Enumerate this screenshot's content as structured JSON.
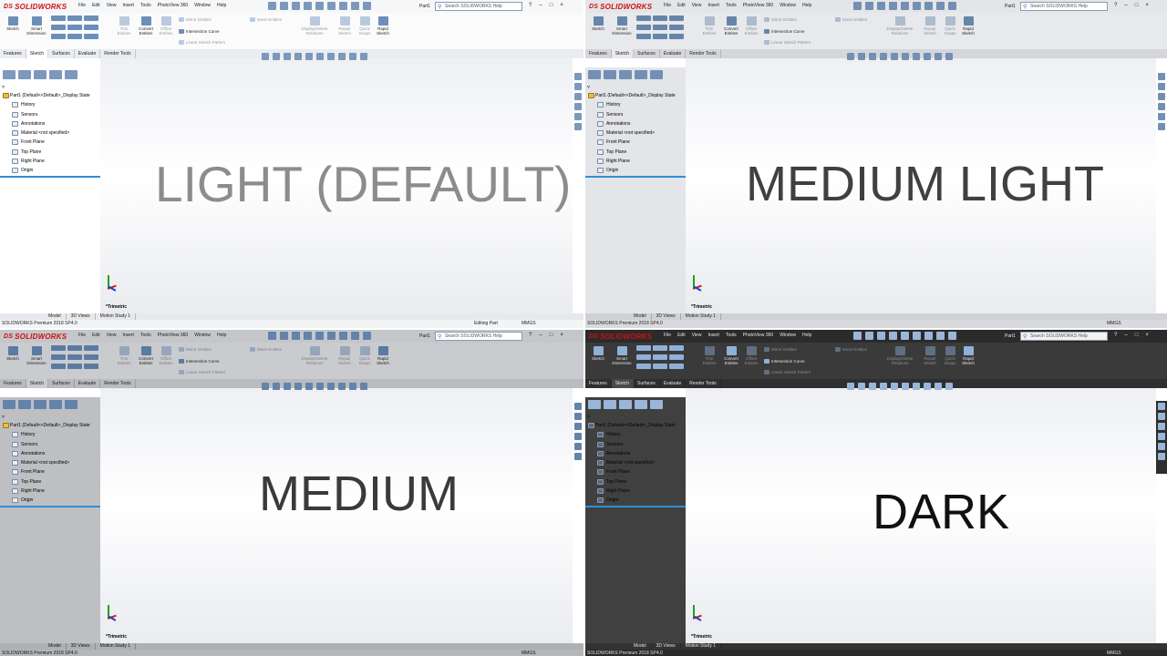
{
  "app": {
    "brand": "SOLIDWORKS",
    "menus": [
      "File",
      "Edit",
      "View",
      "Insert",
      "Tools",
      "PhotoView 360",
      "Window",
      "Help"
    ],
    "doc_title": "Part1",
    "search_placeholder": "Search SOLIDWORKS Help",
    "ribbon": {
      "sketch": "Sketch",
      "smart_dimension": "Smart Dimension",
      "trim_entities": "Trim Entities",
      "convert_entities": "Convert Entities",
      "offset_entities": "Offset Entities",
      "mirror_entities": "Mirror Entities",
      "intersection_curve": "Intersection Curve",
      "linear_sketch_pattern": "Linear Sketch Pattern",
      "move_entities": "Move Entities",
      "display_delete_relations": "Display/Delete Relations",
      "repair_sketch": "Repair Sketch",
      "quick_snaps": "Quick Snaps",
      "rapid_sketch": "Rapid Sketch"
    },
    "tabs": [
      "Features",
      "Sketch",
      "Surfaces",
      "Evaluate",
      "Render Tools"
    ],
    "tree": {
      "root": "Part1  (Default<<Default>_Display State",
      "items": [
        "History",
        "Sensors",
        "Annotations",
        "Material <not specified>",
        "Front Plane",
        "Top Plane",
        "Right Plane",
        "Origin"
      ]
    },
    "view_label": "*Trimetric",
    "bottom_tabs": [
      "Model",
      "3D Views",
      "Motion Study 1"
    ],
    "status_text": "SOLIDWORKS Premium 2018 SP4.0",
    "status_editing": "Editing Part",
    "units": "MMGS"
  },
  "themes": {
    "light": "LIGHT (DEFAULT)",
    "medium_light": "MEDIUM LIGHT",
    "medium": "MEDIUM",
    "dark": "DARK"
  }
}
